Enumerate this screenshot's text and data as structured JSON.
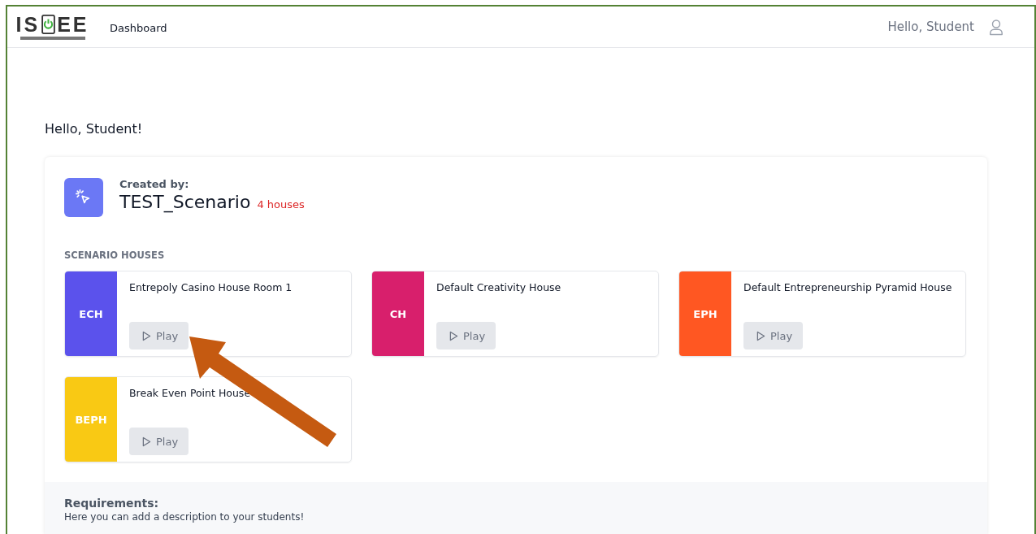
{
  "header": {
    "logo": {
      "left": "IS",
      "right": "EE"
    },
    "nav": [
      {
        "label": "Dashboard"
      }
    ],
    "user_greeting": "Hello, Student"
  },
  "greeting": "Hello, Student!",
  "scenario": {
    "created_by_label": "Created by:",
    "name": "TEST_Scenario",
    "house_count": "4 houses",
    "section_label": "SCENARIO HOUSES",
    "houses": [
      {
        "abbr": "ECH",
        "title": "Entrepoly Casino House Room 1",
        "color": "#5b52ec",
        "button": "Play"
      },
      {
        "abbr": "CH",
        "title": "Default Creativity House",
        "color": "#d81f6c",
        "button": "Play"
      },
      {
        "abbr": "EPH",
        "title": "Default Entrepreneurship Pyramid House",
        "color": "#ff5722",
        "button": "Play"
      },
      {
        "abbr": "BEPH",
        "title": "Break Even Point House",
        "color": "#f9c914",
        "button": "Play"
      }
    ],
    "requirements": {
      "title": "Requirements:",
      "text": "Here you can add a description to your students!"
    }
  }
}
